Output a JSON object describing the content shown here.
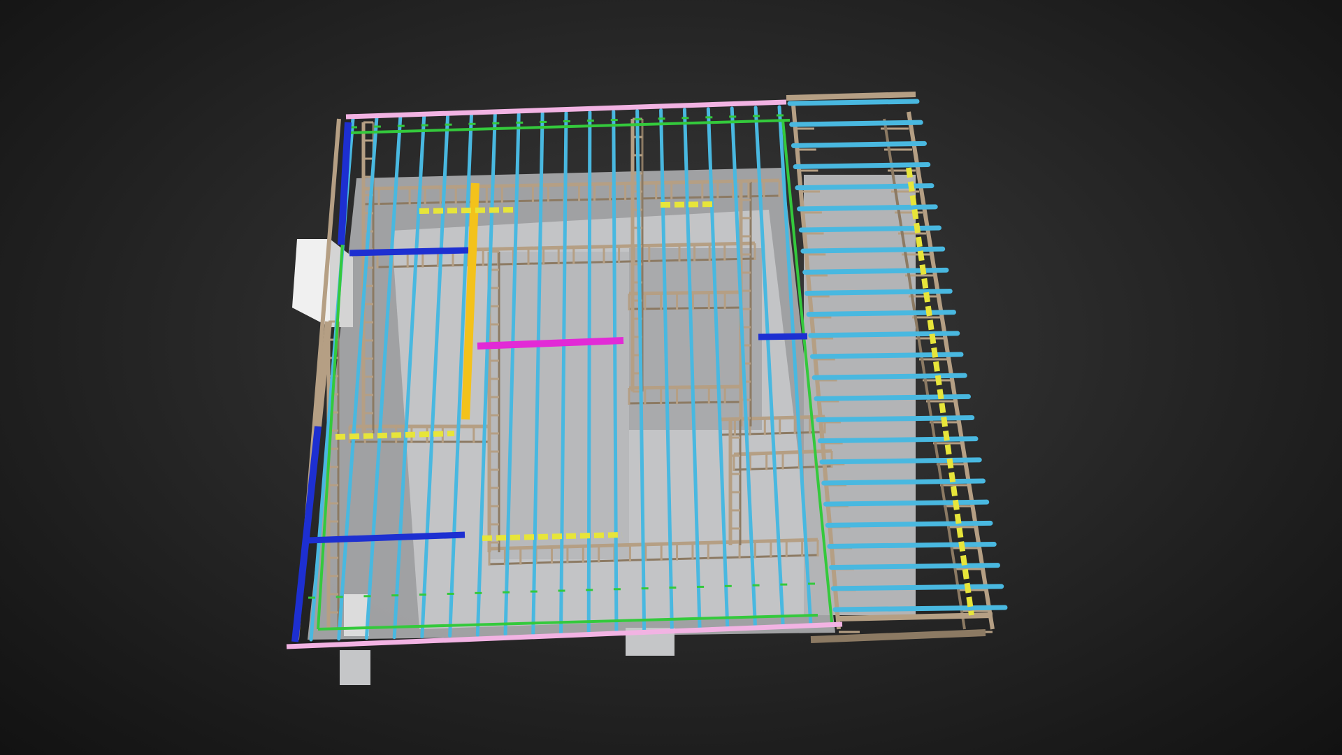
{
  "viewer": {
    "background_inner": "#3a3a3a",
    "background_outer": "#121212"
  },
  "model": {
    "colors": {
      "timber": "#b59f84",
      "timber_dark": "#8c7a63",
      "floor_joist": "#49b8e0",
      "green_plate": "#34c93c",
      "top_plate": "#f2b3e3",
      "blue_beam": "#1d2fd1",
      "yellow_beam": "#f3c21b",
      "yellow_block": "#e7e53a",
      "magenta_beam": "#e22ad6",
      "concrete": "#c8c9cb",
      "shadow": "#9a9b9d",
      "white_box": "#eeeeee"
    },
    "joist_icon": "floor-joist-icon",
    "beam_icon": "beam-icon"
  }
}
